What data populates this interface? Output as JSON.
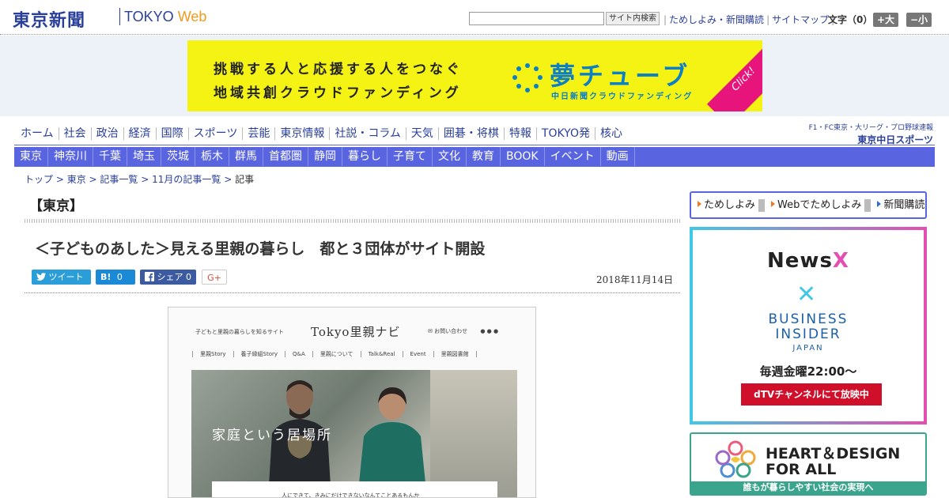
{
  "header": {
    "logo_jp": "東京新聞",
    "logo_en_prefix": "TOKYO",
    "logo_en_suffix": "Web",
    "search_button": "サイト内検索",
    "links": [
      "ためしよみ・新聞購読",
      "サイトマップ"
    ],
    "font_size_label": "文字（0）",
    "font_bigger": "+大",
    "font_smaller": "−小"
  },
  "banner": {
    "line1": "挑戦する人と応援する人をつなぐ",
    "line2": "地域共創クラウドファンディング",
    "title": "夢チューブ",
    "subtitle": "中日新聞クラウドファンディング",
    "click": "Click!"
  },
  "nav_main": [
    "ホーム",
    "社会",
    "政治",
    "経済",
    "国際",
    "スポーツ",
    "芸能",
    "東京情報",
    "社説・コラム",
    "天気",
    "囲碁・将棋",
    "特報",
    "TOKYO発",
    "核心"
  ],
  "nav_right": {
    "top": "F1・FC東京・大リーグ・プロ野球速報",
    "bottom": "東京中日スポーツ"
  },
  "nav_sub": [
    "東京",
    "神奈川",
    "千葉",
    "埼玉",
    "茨城",
    "栃木",
    "群馬",
    "首都圏",
    "静岡",
    "暮らし",
    "子育て",
    "文化",
    "教育",
    "BOOK",
    "イベント",
    "動画"
  ],
  "breadcrumb": {
    "items": [
      "トップ",
      "東京",
      "記事一覧",
      "11月の記事一覧"
    ],
    "current": "記事",
    "sep": " > "
  },
  "article": {
    "section": "【東京】",
    "headline": "＜子どものあした＞見える里親の暮らし　都と３団体がサイト開設",
    "date": "2018年11月14日",
    "share": {
      "tweet": "ツイート",
      "hatena": "B!",
      "hatena_count": "0",
      "facebook": "シェア",
      "facebook_count": "0",
      "gplus": "G+"
    }
  },
  "article_image": {
    "site_tag": "子どもと里親の暮らしを知るサイト",
    "site_name": "Tokyo里親ナビ",
    "contact": "お問い合わせ",
    "menu": [
      "里親Story",
      "養子縁組Story",
      "Q&A",
      "里親について",
      "Talk&Real",
      "Event",
      "里親図書館"
    ],
    "overlay": "家庭という居場所",
    "caption": "人にできて、きみにだけできないなんてことあるもんか"
  },
  "sidebar": {
    "tabs": [
      "ためしよみ",
      "Webでためしよみ",
      "新聞購読"
    ],
    "ad_newsx": {
      "brand_a": "News",
      "brand_b": "X",
      "cross": "✕",
      "bi_line1": "BUSINESS",
      "bi_line2": "INSIDER",
      "bi_line3": "JAPAN",
      "weekly": "毎週金曜22:00〜",
      "cta": "dTVチャンネルにて放映中"
    },
    "ad_heart": {
      "line1": "HEART＆DESIGN",
      "line2": "FOR ALL",
      "bar": "誰もが暮らしやすい社会の実現へ"
    }
  },
  "colors": {
    "brand_blue": "#2a3f9a",
    "nav_sub_bg": "#5864e0",
    "banner_yellow": "#f4f314",
    "banner_blue": "#0d7fc4",
    "click_pink": "#e7157b",
    "dtv_red": "#d0102b",
    "heart_green": "#3aa48c"
  }
}
